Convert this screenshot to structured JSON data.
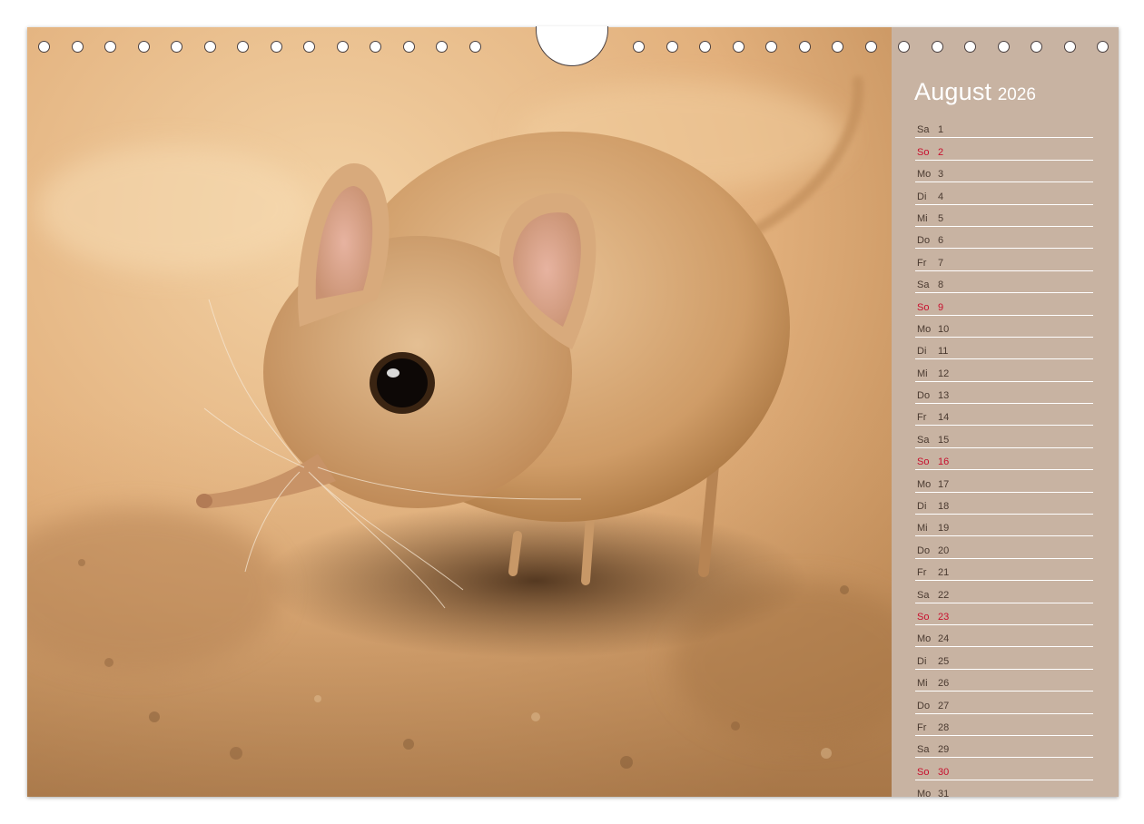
{
  "calendar": {
    "month": "August",
    "year": "2026",
    "colors": {
      "panel": "#c8b3a2",
      "sunday": "#c8102e",
      "text": "#4a3a30"
    },
    "days": [
      {
        "wd": "Sa",
        "n": "1"
      },
      {
        "wd": "So",
        "n": "2"
      },
      {
        "wd": "Mo",
        "n": "3"
      },
      {
        "wd": "Di",
        "n": "4"
      },
      {
        "wd": "Mi",
        "n": "5"
      },
      {
        "wd": "Do",
        "n": "6"
      },
      {
        "wd": "Fr",
        "n": "7"
      },
      {
        "wd": "Sa",
        "n": "8"
      },
      {
        "wd": "So",
        "n": "9"
      },
      {
        "wd": "Mo",
        "n": "10"
      },
      {
        "wd": "Di",
        "n": "11"
      },
      {
        "wd": "Mi",
        "n": "12"
      },
      {
        "wd": "Do",
        "n": "13"
      },
      {
        "wd": "Fr",
        "n": "14"
      },
      {
        "wd": "Sa",
        "n": "15"
      },
      {
        "wd": "So",
        "n": "16"
      },
      {
        "wd": "Mo",
        "n": "17"
      },
      {
        "wd": "Di",
        "n": "18"
      },
      {
        "wd": "Mi",
        "n": "19"
      },
      {
        "wd": "Do",
        "n": "20"
      },
      {
        "wd": "Fr",
        "n": "21"
      },
      {
        "wd": "Sa",
        "n": "22"
      },
      {
        "wd": "So",
        "n": "23"
      },
      {
        "wd": "Mo",
        "n": "24"
      },
      {
        "wd": "Di",
        "n": "25"
      },
      {
        "wd": "Mi",
        "n": "26"
      },
      {
        "wd": "Do",
        "n": "27"
      },
      {
        "wd": "Fr",
        "n": "28"
      },
      {
        "wd": "Sa",
        "n": "29"
      },
      {
        "wd": "So",
        "n": "30"
      },
      {
        "wd": "Mo",
        "n": "31"
      }
    ]
  },
  "photo": {
    "subject": "elephant-shrew-photo"
  }
}
